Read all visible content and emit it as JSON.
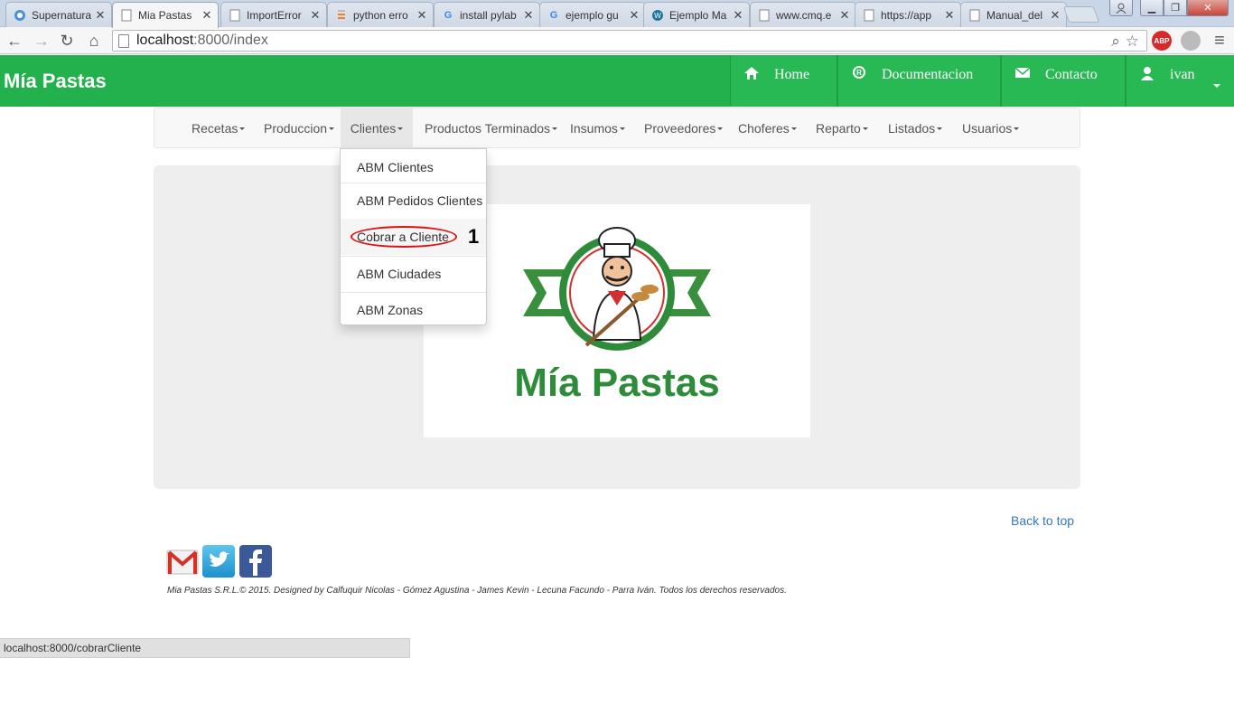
{
  "browser": {
    "tabs": [
      {
        "title": "Supernatura",
        "icon": "circle-arrow-icon"
      },
      {
        "title": "Mia Pastas",
        "icon": "page-icon",
        "active": true
      },
      {
        "title": "ImportError",
        "icon": "page-icon"
      },
      {
        "title": "python erro",
        "icon": "stack-icon"
      },
      {
        "title": "install pylab",
        "icon": "google-icon"
      },
      {
        "title": "ejemplo gu",
        "icon": "google-icon"
      },
      {
        "title": "Ejemplo Ma",
        "icon": "wordpress-icon"
      },
      {
        "title": "www.cmq.e",
        "icon": "page-icon"
      },
      {
        "title": "https://app",
        "icon": "page-icon"
      },
      {
        "title": "Manual_del",
        "icon": "page-icon"
      }
    ],
    "address": {
      "host": "localhost",
      "path": ":8000/index"
    },
    "status_url": "localhost:8000/cobrarCliente",
    "abp_label": "ABP"
  },
  "app": {
    "brand": "Mía Pastas",
    "topnav": [
      {
        "label": "Home",
        "icon": "home-icon"
      },
      {
        "label": "Documentacion",
        "icon": "registered-icon"
      },
      {
        "label": "Contacto",
        "icon": "envelope-icon"
      },
      {
        "label": "ivan",
        "icon": "user-icon"
      }
    ],
    "menu": [
      "Recetas",
      "Produccion",
      "Clientes",
      "Productos Terminados",
      "Insumos",
      "Proveedores",
      "Choferes",
      "Reparto",
      "Listados",
      "Usuarios"
    ],
    "open_menu": "Clientes",
    "dropdown": [
      "ABM Clientes",
      "ABM Pedidos Clientes",
      "Cobrar a Cliente",
      "ABM Ciudades",
      "ABM Zonas"
    ],
    "annotation": "1",
    "logo_text": "Mía Pastas",
    "back_to_top": "Back to top",
    "social": [
      "gmail-icon",
      "twitter-icon",
      "facebook-icon"
    ],
    "credits": "Mia Pastas S.R.L.© 2015. Designed by Calfuquir Nicolas - Gómez Agustina - James Kevin - Lecuna Facundo - Parra Iván. Todos los derechos reservados.",
    "colors": {
      "navbar": "#23b14d",
      "link": "#337ab7",
      "annotation": "#dd1111"
    }
  }
}
